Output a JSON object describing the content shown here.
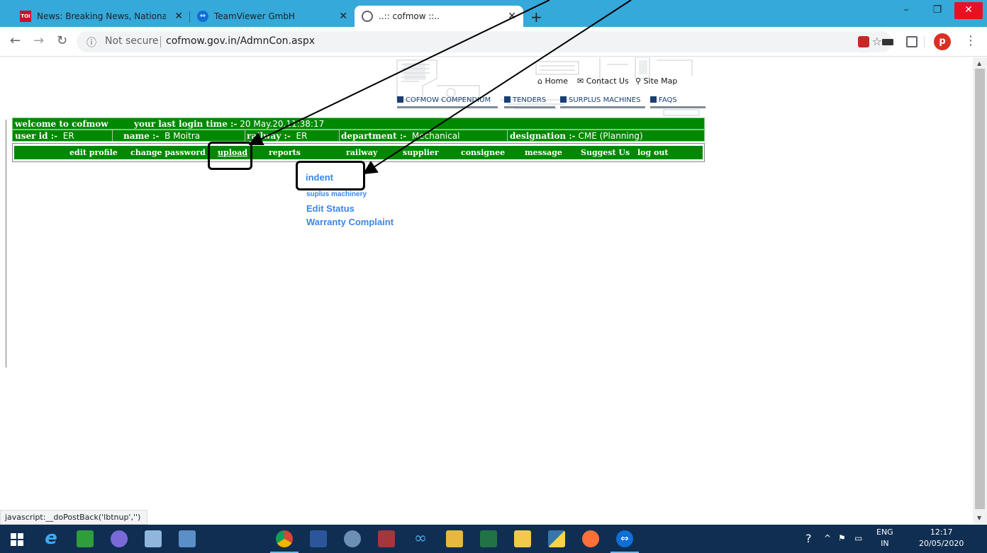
{
  "browser": {
    "tabs": [
      {
        "title": "News: Breaking News, National n",
        "favicon": "toi-icon",
        "active": false
      },
      {
        "title": "TeamViewer GmbH",
        "favicon": "teamviewer-icon",
        "active": false
      },
      {
        "title": "..:: cofmow ::..",
        "favicon": "globe-icon",
        "active": true
      }
    ],
    "new_tab": "+",
    "window_controls": {
      "minimize": "–",
      "maximize": "❐",
      "close": "✕"
    },
    "security": "Not secure",
    "url": "cofmow.gov.in/AdmnCon.aspx",
    "profile_initial": "p",
    "status_bar": "javascript:__doPostBack('lbtnup','')",
    "accent_color": "#35a9da"
  },
  "site": {
    "top_links": {
      "home": "Home",
      "contact": "Contact Us",
      "sitemap": "Site Map"
    },
    "section_links": [
      "COFMOW COMPENDIUM",
      "TENDERS",
      "SURPLUS MACHINES",
      "FAQS"
    ],
    "welcome": "welcome to cofmow",
    "last_login_label": "your last login time :-",
    "last_login_value": "20 May.20,11:38:17",
    "user_id_label": "user id :-",
    "user_id_value": "ER",
    "name_label": "name :-",
    "name_value": "B Moitra",
    "railway_label": "railway :-",
    "railway_value": "ER",
    "department_label": "department :-",
    "department_value": "Mechanical",
    "designation_label": "designation :-",
    "designation_value": "CME (Planning)",
    "menu": [
      "edit profile",
      "change password",
      "upload",
      "reports",
      "railway",
      "supplier",
      "consignee",
      "message",
      "Suggest Us",
      "log out"
    ],
    "upload_submenu": [
      "indent",
      "suplus machinery",
      "Edit Status",
      "Warranty Complaint"
    ],
    "green_color": "#008800",
    "submenu_color": "#3a86e8"
  },
  "taskbar": {
    "apps": [
      "windows-start",
      "internet-explorer",
      "store",
      "media-center",
      "remote-desktop",
      "task-manager",
      "chrome",
      "word",
      "snipping-tool",
      "access",
      "infinity-app",
      "paint",
      "excel",
      "file-explorer",
      "python",
      "firefox",
      "teamviewer"
    ],
    "lang_top": "ENG",
    "lang_bottom": "IN",
    "time": "12:17",
    "date": "20/05/2020"
  }
}
